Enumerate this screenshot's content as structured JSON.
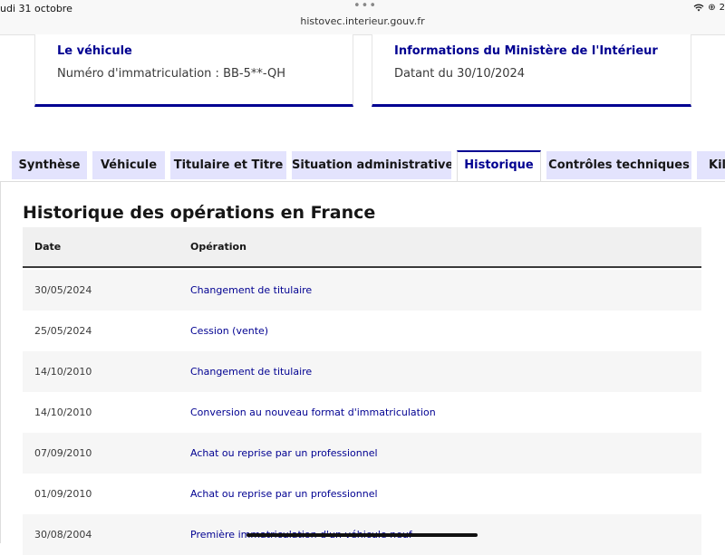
{
  "status_bar": {
    "time": "udi 31 octobre",
    "url": "histovec.interieur.gouv.fr",
    "battery": "2"
  },
  "cards": [
    {
      "title": "Le véhicule",
      "value": "Numéro d'immatriculation : BB-5**-QH"
    },
    {
      "title": "Informations du Ministère de l'Intérieur",
      "value": "Datant du 30/10/2024"
    }
  ],
  "tabs": [
    {
      "label": "Synthèse"
    },
    {
      "label": "Véhicule"
    },
    {
      "label": "Titulaire et Titre"
    },
    {
      "label": "Situation administrative"
    },
    {
      "label": "Historique",
      "active": true
    },
    {
      "label": "Contrôles techniques"
    },
    {
      "label": "Kilo"
    }
  ],
  "main": {
    "title": "Historique des opérations en France",
    "columns": [
      "Date",
      "Opération"
    ],
    "rows": [
      {
        "date": "30/05/2024",
        "operation": "Changement de titulaire"
      },
      {
        "date": "25/05/2024",
        "operation": "Cession (vente)"
      },
      {
        "date": "14/10/2010",
        "operation": "Changement de titulaire"
      },
      {
        "date": "14/10/2010",
        "operation": "Conversion au nouveau format d'immatriculation"
      },
      {
        "date": "07/09/2010",
        "operation": "Achat ou reprise par un professionnel"
      },
      {
        "date": "01/09/2010",
        "operation": "Achat ou reprise par un professionnel"
      },
      {
        "date": "30/08/2004",
        "operation": "Première immatriculation d'un véhicule neuf"
      }
    ]
  },
  "colors": {
    "accent": "#000091",
    "tab_bg": "#e3e3fd",
    "row_alt": "#f6f6f6",
    "header_bg": "#f0f0f0"
  }
}
